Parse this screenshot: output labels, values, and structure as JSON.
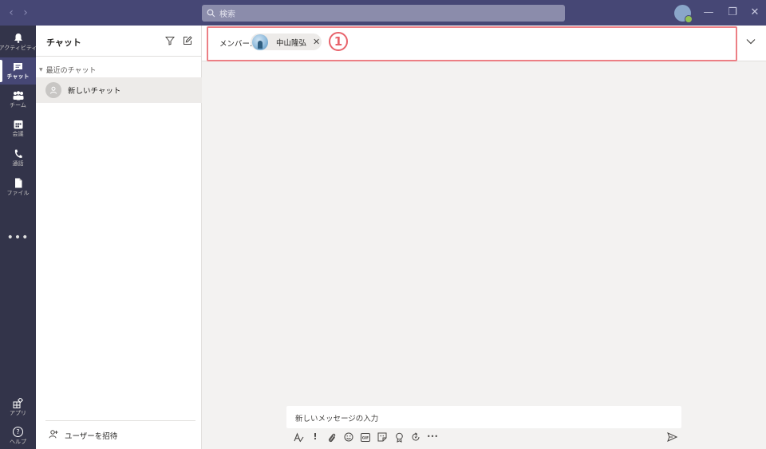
{
  "titlebar": {
    "back_glyph": "‹",
    "forward_glyph": "›",
    "search_placeholder": "検索",
    "minimize_glyph": "—",
    "maximize_glyph": "❐",
    "close_glyph": "✕"
  },
  "rail": {
    "items": [
      {
        "label": "アクティビティ",
        "icon": "bell-icon"
      },
      {
        "label": "チャット",
        "icon": "chat-icon"
      },
      {
        "label": "チーム",
        "icon": "teams-icon"
      },
      {
        "label": "会議",
        "icon": "calendar-icon"
      },
      {
        "label": "通話",
        "icon": "phone-icon"
      },
      {
        "label": "ファイル",
        "icon": "file-icon"
      }
    ],
    "more_glyph": "•••",
    "apps_label": "アプリ",
    "help_label": "ヘルプ",
    "help_glyph": "?"
  },
  "list": {
    "title": "チャット",
    "section_label": "最近のチャット",
    "new_chat_label": "新しいチャット",
    "invite_label": "ユーザーを招待"
  },
  "header": {
    "members_label": "メンバー:",
    "member_name": "中山隆弘",
    "remove_glyph": "✕",
    "annotation": "1"
  },
  "compose": {
    "placeholder": "新しいメッセージの入力",
    "toolbar_glyphs": {
      "urgent": "!",
      "more": "•••"
    }
  },
  "colors": {
    "titlebar": "#464775",
    "rail": "#33344a",
    "accent": "#464775",
    "highlight": "#ec7f85",
    "annotation": "#e8636b"
  }
}
